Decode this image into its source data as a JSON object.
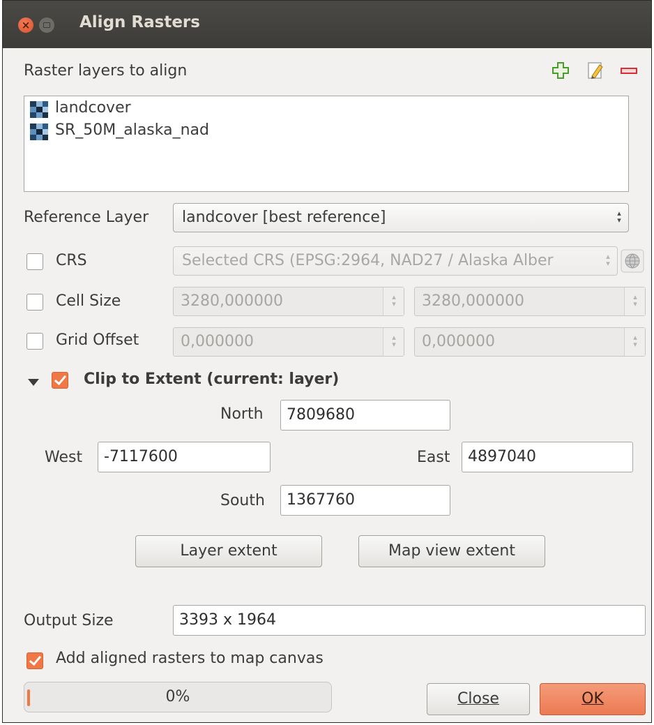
{
  "window": {
    "title": "Align Rasters"
  },
  "layers": {
    "label": "Raster layers to align",
    "items": [
      "landcover",
      "SR_50M_alaska_nad"
    ],
    "icons": [
      "add-layer-icon",
      "edit-layer-icon",
      "remove-layer-icon"
    ]
  },
  "reference": {
    "label": "Reference Layer",
    "value": "landcover [best reference]"
  },
  "crs": {
    "label": "CRS",
    "checked": false,
    "value": "Selected CRS (EPSG:2964, NAD27 / Alaska Alber"
  },
  "cell_size": {
    "label": "Cell Size",
    "checked": false,
    "x": "3280,000000",
    "y": "3280,000000"
  },
  "grid_offset": {
    "label": "Grid Offset",
    "checked": false,
    "x": "0,000000",
    "y": "0,000000"
  },
  "clip": {
    "label": "Clip to Extent (current: layer)",
    "checked": true,
    "north_label": "North",
    "north": "7809680",
    "west_label": "West",
    "west": "-7117600",
    "east_label": "East",
    "east": "4897040",
    "south_label": "South",
    "south": "1367760",
    "layer_extent_button": "Layer extent",
    "map_view_extent_button": "Map view extent"
  },
  "output": {
    "label": "Output Size",
    "value": "3393 x 1964"
  },
  "add_to_canvas": {
    "label": "Add aligned rasters to map canvas",
    "checked": true
  },
  "progress": {
    "text": "0%",
    "value": 0
  },
  "buttons": {
    "close": "Close",
    "ok": "OK"
  },
  "colors": {
    "accent": "#f07746",
    "titlebar": "#3d3c38"
  }
}
